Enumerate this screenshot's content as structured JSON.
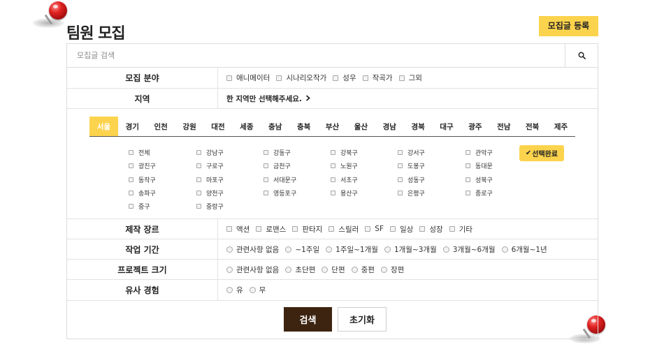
{
  "page": {
    "title": "팀원 모집",
    "register_button": "모집글 등록"
  },
  "search": {
    "placeholder": "모집글 검색",
    "icon": "search-icon"
  },
  "filters": {
    "field": {
      "label": "모집 분야",
      "options": [
        "애니메이터",
        "시나리오작가",
        "성우",
        "작곡가",
        "그외"
      ]
    },
    "region": {
      "label": "지역",
      "hint": "한 지역만 선택해주세요."
    },
    "genre": {
      "label": "제작 장르",
      "options": [
        "액션",
        "로맨스",
        "판타지",
        "스릴러",
        "SF",
        "일상",
        "성장",
        "기타"
      ]
    },
    "period": {
      "label": "작업 기간",
      "options": [
        "관련사항 없음",
        "~1주일",
        "1주일~1개월",
        "1개월~3개월",
        "3개월~6개월",
        "6개월~1년"
      ]
    },
    "size": {
      "label": "프로젝트 크기",
      "options": [
        "관련사항 없음",
        "초단편",
        "단편",
        "중편",
        "장편"
      ]
    },
    "experience": {
      "label": "유사 경험",
      "options": [
        "유",
        "무"
      ]
    }
  },
  "region_panel": {
    "tabs": [
      "서울",
      "경기",
      "인천",
      "강원",
      "대전",
      "세종",
      "충남",
      "충북",
      "부산",
      "울산",
      "경남",
      "경북",
      "대구",
      "광주",
      "전남",
      "전북",
      "제주"
    ],
    "active_tab": "서울",
    "districts": [
      [
        "전체",
        "강남구",
        "강동구",
        "강북구",
        "강서구",
        "관악구"
      ],
      [
        "광진구",
        "구로구",
        "금천구",
        "노원구",
        "도봉구",
        "동대문"
      ],
      [
        "동작구",
        "마포구",
        "서대문구",
        "서초구",
        "성동구",
        "성북구"
      ],
      [
        "송파구",
        "양천구",
        "영등포구",
        "용산구",
        "은평구",
        "종로구"
      ],
      [
        "중구",
        "중랑구"
      ]
    ],
    "done_button": "선택완료"
  },
  "actions": {
    "search": "검색",
    "reset": "초기화"
  },
  "colors": {
    "accent": "#fcd34d",
    "primary_button": "#3d2410",
    "border": "#dcdcdc"
  }
}
